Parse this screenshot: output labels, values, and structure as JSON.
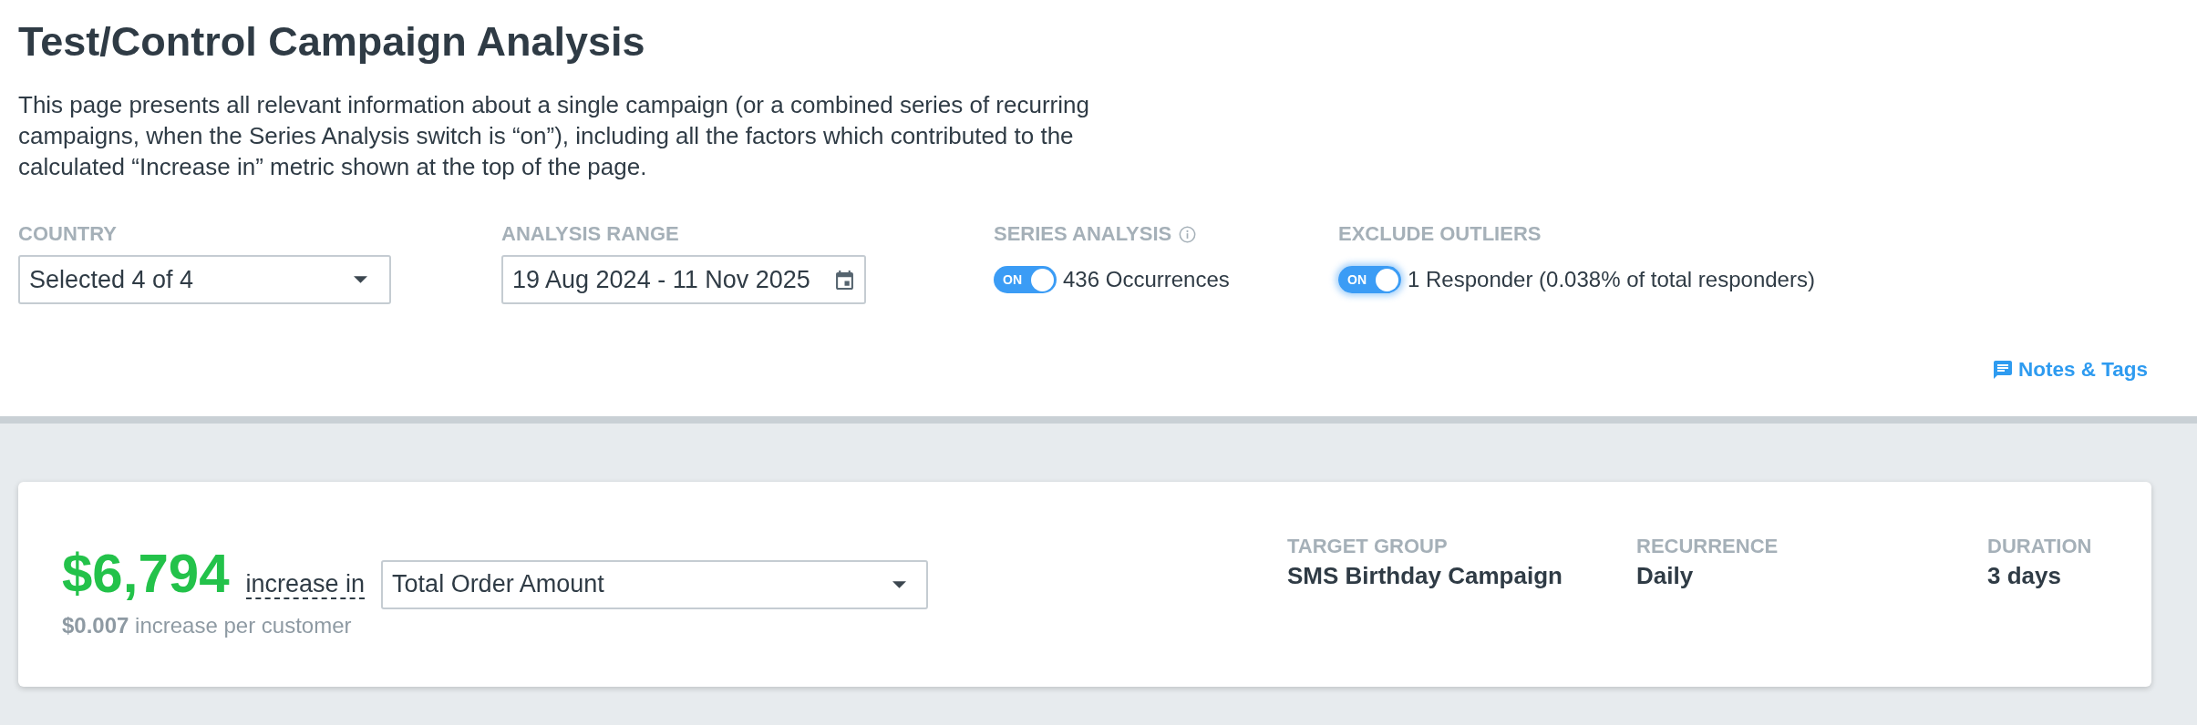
{
  "page": {
    "title": "Test/Control Campaign Analysis",
    "description": "This page presents all relevant information about a single campaign (or a combined series of recurring campaigns, when the Series Analysis switch is “on”), including all the factors which contributed to the calculated “Increase in” metric shown at the top of the page."
  },
  "filters": [
    {
      "kind": "select",
      "label": "COUNTRY",
      "value": "Selected 4 of 4"
    },
    {
      "kind": "date",
      "label": "ANALYSIS RANGE",
      "value": "19 Aug 2024 - 11 Nov 2025"
    },
    {
      "kind": "toggle",
      "label": "SERIES ANALYSIS",
      "info": true,
      "switch_label": "ON",
      "on": true,
      "focused": false,
      "text": "436 Occurrences"
    },
    {
      "kind": "toggle",
      "label": "EXCLUDE OUTLIERS",
      "info": false,
      "switch_label": "ON",
      "on": true,
      "focused": true,
      "text": "1 Responder (0.038% of total responders)"
    }
  ],
  "notes_link": "Notes & Tags",
  "summary": {
    "amount": "$6,794",
    "increase_label": "increase in",
    "metric": "Total Order Amount",
    "per_customer": "**$0.007** increase per customer",
    "details": [
      {
        "label": "TARGET GROUP",
        "value": "SMS Birthday Campaign"
      },
      {
        "label": "RECURRENCE",
        "value": "Daily"
      },
      {
        "label": "DURATION",
        "value": "3 days"
      }
    ]
  }
}
